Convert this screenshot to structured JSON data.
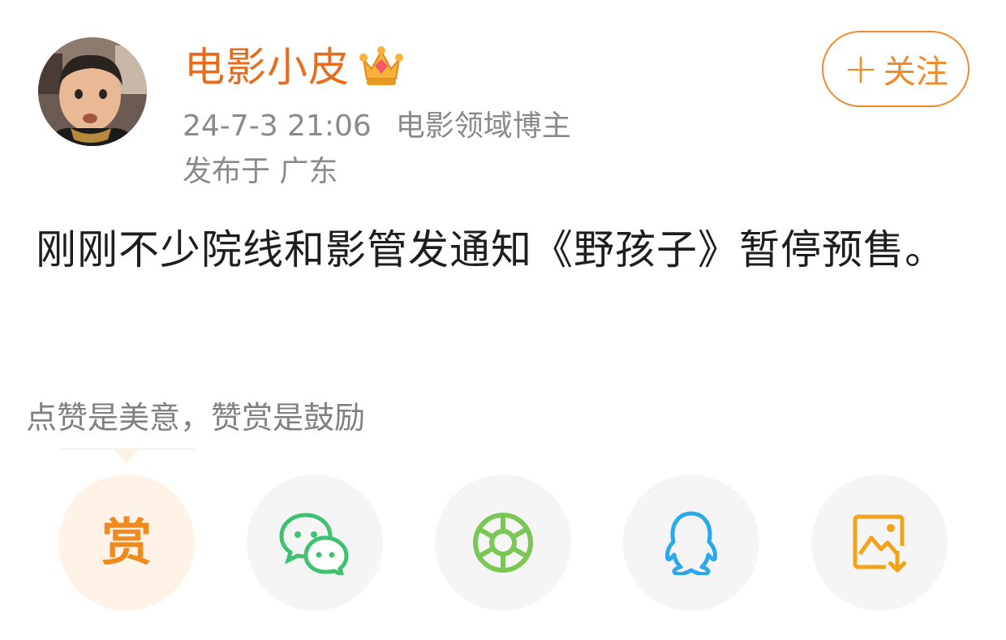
{
  "header": {
    "username": "电影小皮",
    "timestamp": "24-7-3 21:06",
    "user_tag": "电影领域博主",
    "location": "发布于 广东"
  },
  "follow_button": {
    "plus": "+",
    "label": "关注"
  },
  "post": {
    "text": "刚刚不少院线和影管发通知《野孩子》暂停预售。"
  },
  "reward": {
    "hint": "点赞是美意，赞赏是鼓励",
    "button_glyph": "赏"
  },
  "share_buttons": [
    {
      "icon": "reward-icon"
    },
    {
      "icon": "wechat-icon"
    },
    {
      "icon": "moments-icon"
    },
    {
      "icon": "qq-icon"
    },
    {
      "icon": "save-image-icon"
    }
  ],
  "colors": {
    "username": "#e86c19",
    "follow": "#f08a2a",
    "meta_text": "#8a8a8a",
    "wechat": "#3ec271",
    "moments": "#7ac756",
    "qq": "#2aa8ea",
    "save": "#f5a21b"
  }
}
